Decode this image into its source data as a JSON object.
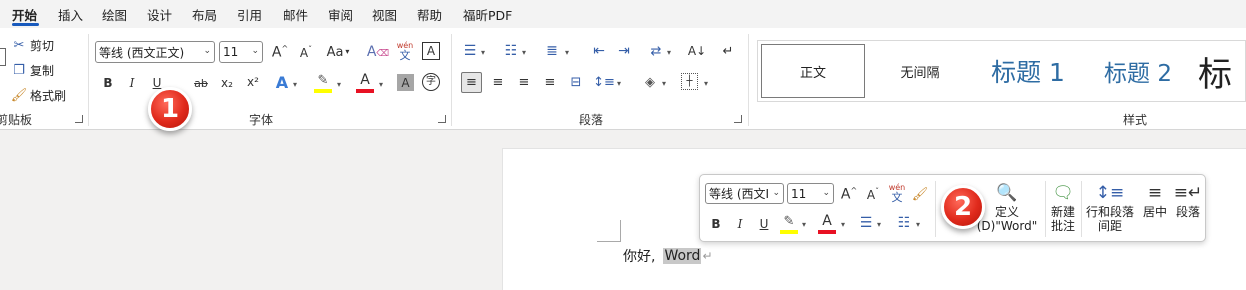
{
  "tabs": [
    "开始",
    "插入",
    "绘图",
    "设计",
    "布局",
    "引用",
    "邮件",
    "审阅",
    "视图",
    "帮助",
    "福昕PDF"
  ],
  "ribbon": {
    "clipboard": {
      "cut": "剪切",
      "copy": "复制",
      "format_painter": "格式刷",
      "group_label": "剪贴板"
    },
    "font": {
      "font_name": "等线 (西文正文)",
      "font_size": "11",
      "grow_font": "A^",
      "shrink_font": "Aˇ",
      "change_case": "Aa",
      "clear_format": "A",
      "phonetic_top": "wén",
      "phonetic_bottom": "文",
      "char_border": "A",
      "bold": "B",
      "italic": "I",
      "underline": "U",
      "strikethrough": "ab",
      "subscript": "x₂",
      "superscript": "x²",
      "text_effect": "A",
      "highlight_color": "#ffff00",
      "font_color": "A",
      "font_color_value": "#e81123",
      "char_shading": "A",
      "enclose_char": "字",
      "group_label": "字体"
    },
    "paragraph": {
      "group_label": "段落"
    },
    "styles": {
      "normal": "正文",
      "no_spacing": "无间隔",
      "heading1": "标题 1",
      "heading2": "标题 2",
      "heading_partial": "标",
      "group_label": "样式"
    }
  },
  "document": {
    "text_before": "你好,",
    "selected_text": "Word",
    "paragraph_mark": "↵"
  },
  "mini_toolbar": {
    "font_name": "等线 (西文I",
    "font_size": "11",
    "define_label": "定义",
    "define_sub": "(D)\"Word\"",
    "new_comment_line1": "新建",
    "new_comment_line2": "批注",
    "line_spacing_line1": "行和段落",
    "line_spacing_line2": "间距",
    "center": "居中",
    "paragraph": "段落"
  },
  "callouts": [
    "1",
    "2"
  ],
  "colors": {
    "accent": "#185abd",
    "heading": "#2e6ca3",
    "highlight": "#ffff00",
    "font_red": "#e81123",
    "badge": "#e02a1c"
  }
}
